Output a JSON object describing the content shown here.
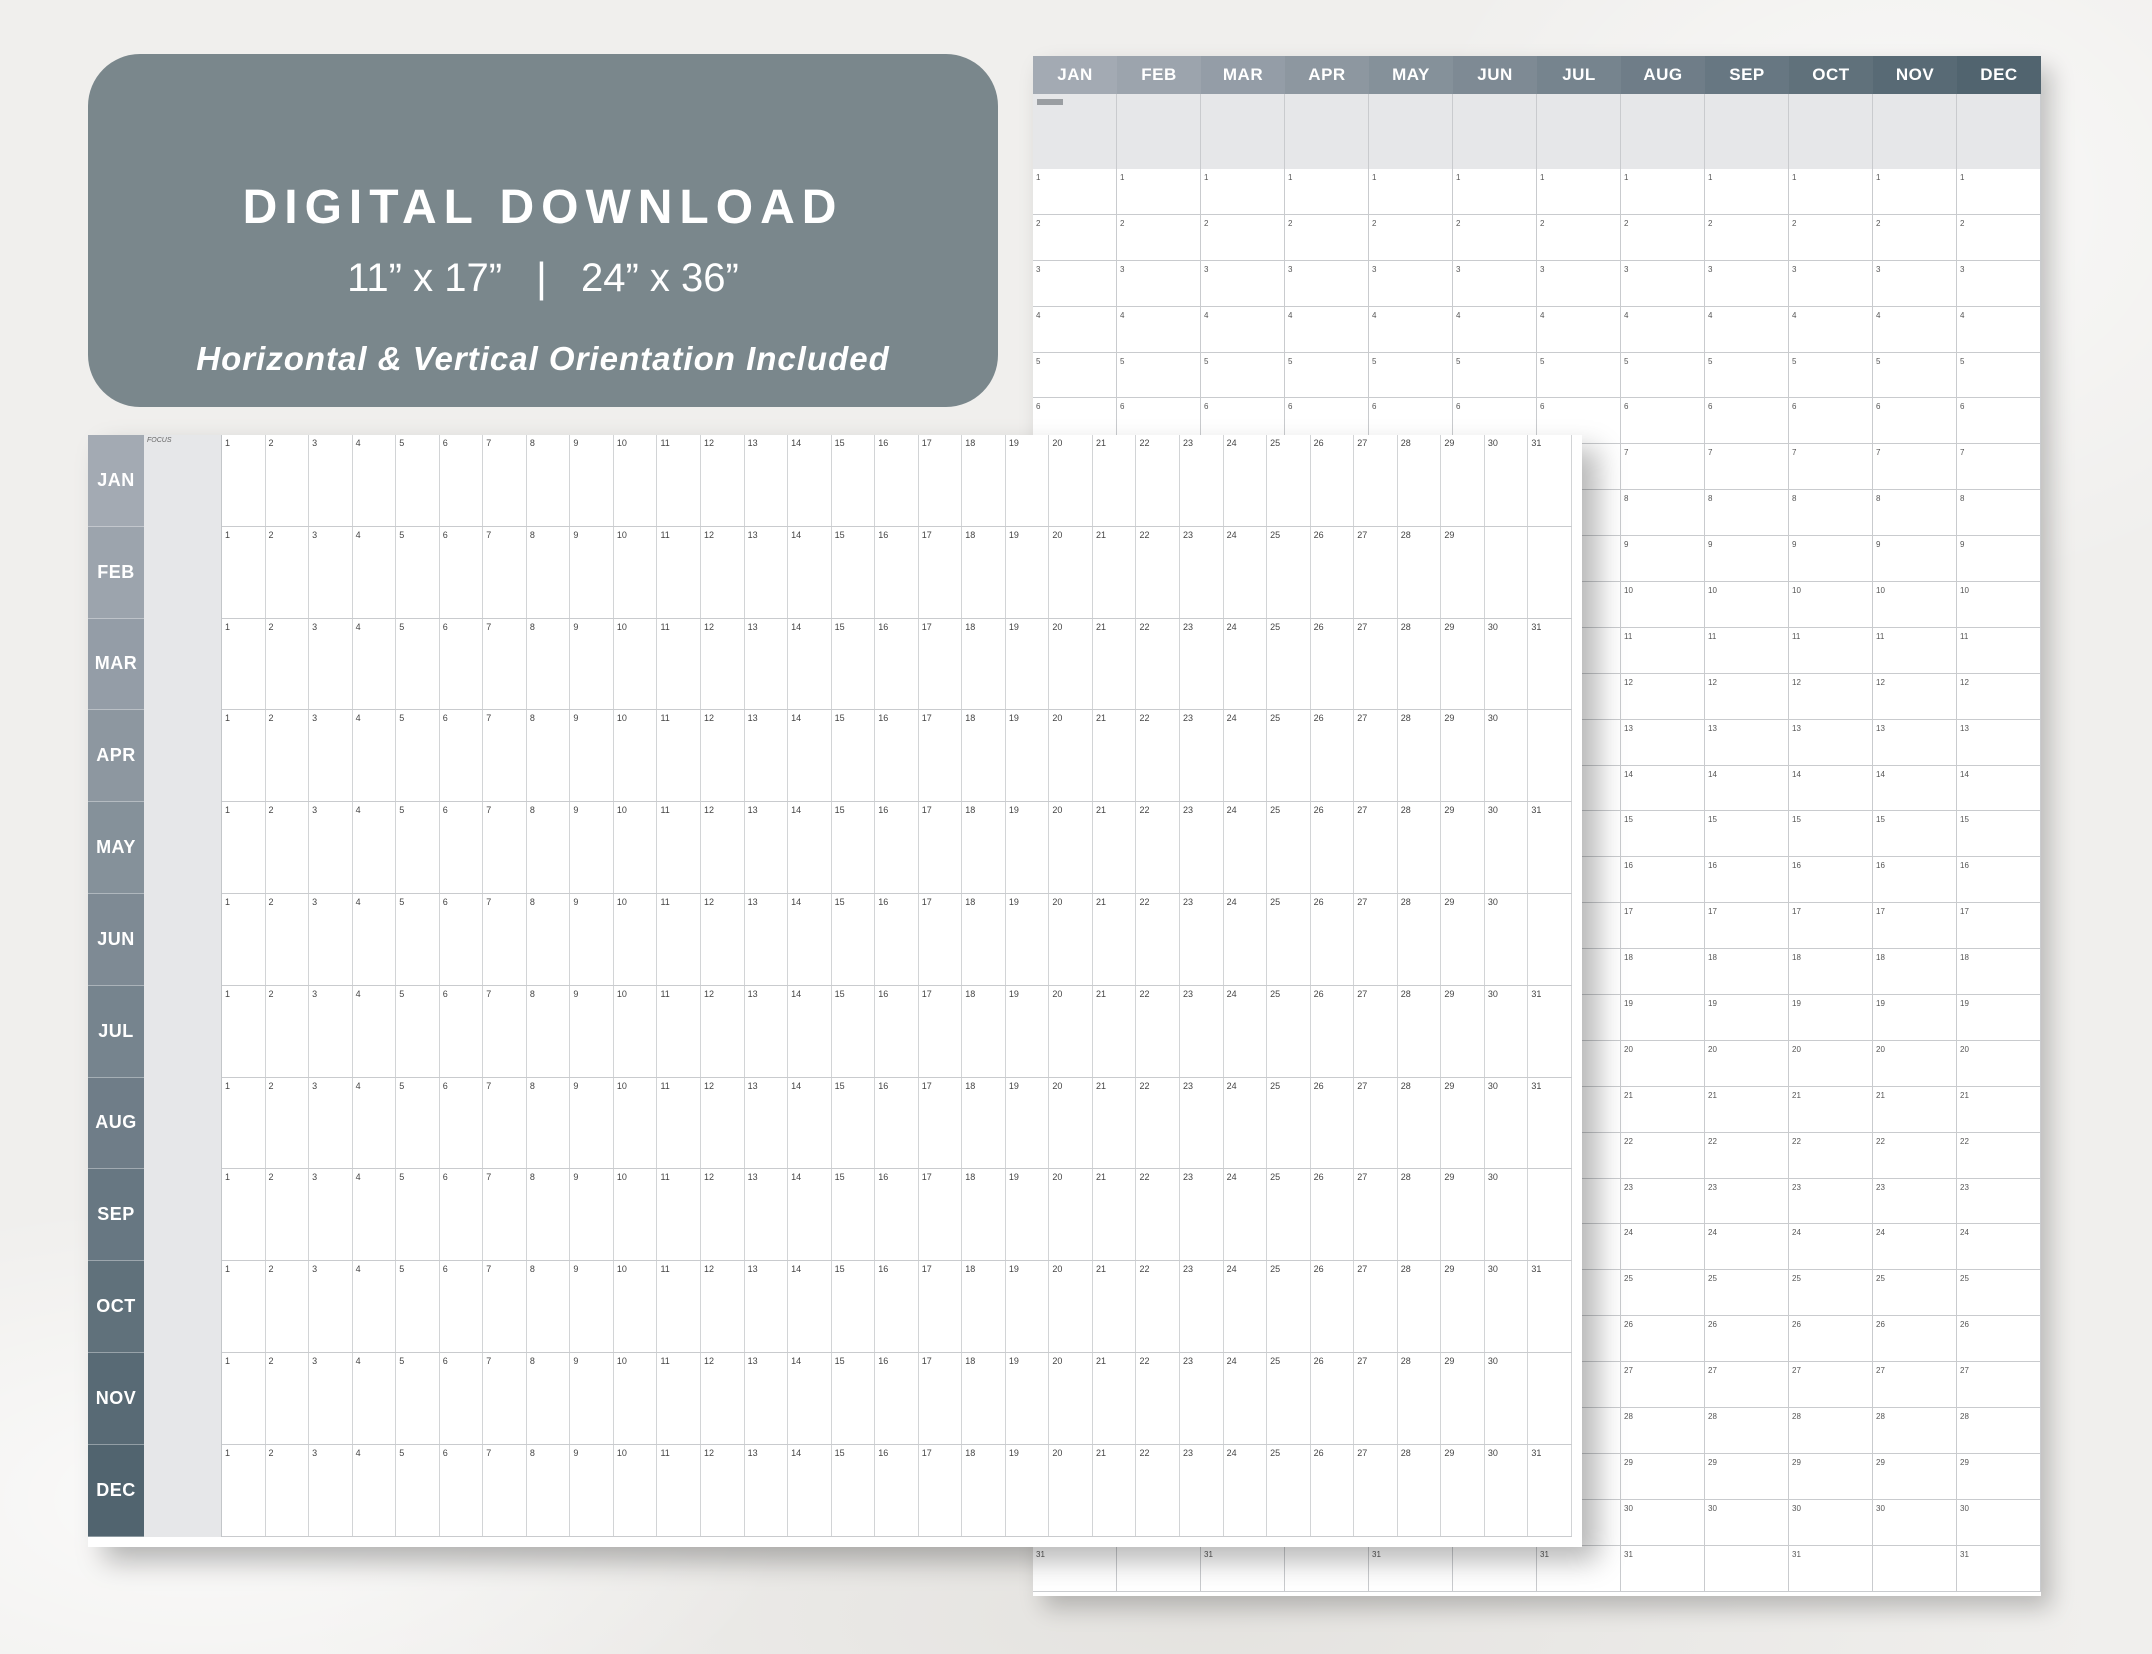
{
  "banner": {
    "title": "DIGITAL DOWNLOAD",
    "size_small": "11” x 17”",
    "separator": "|",
    "size_large": "24” x 36”",
    "subtitle": "Horizontal & Vertical Orientation Included"
  },
  "months": [
    "JAN",
    "FEB",
    "MAR",
    "APR",
    "MAY",
    "JUN",
    "JUL",
    "AUG",
    "SEP",
    "OCT",
    "NOV",
    "DEC"
  ],
  "days_in_month": [
    31,
    29,
    31,
    30,
    31,
    30,
    31,
    31,
    30,
    31,
    30,
    31
  ],
  "focus_label": "FOCUS",
  "colors": {
    "banner": "#7a878c",
    "month_gradient_start": "#a3aab3",
    "month_gradient_end": "#51646f",
    "focus_column": "#e6e7e9",
    "grid_line": "#c9cbce"
  }
}
